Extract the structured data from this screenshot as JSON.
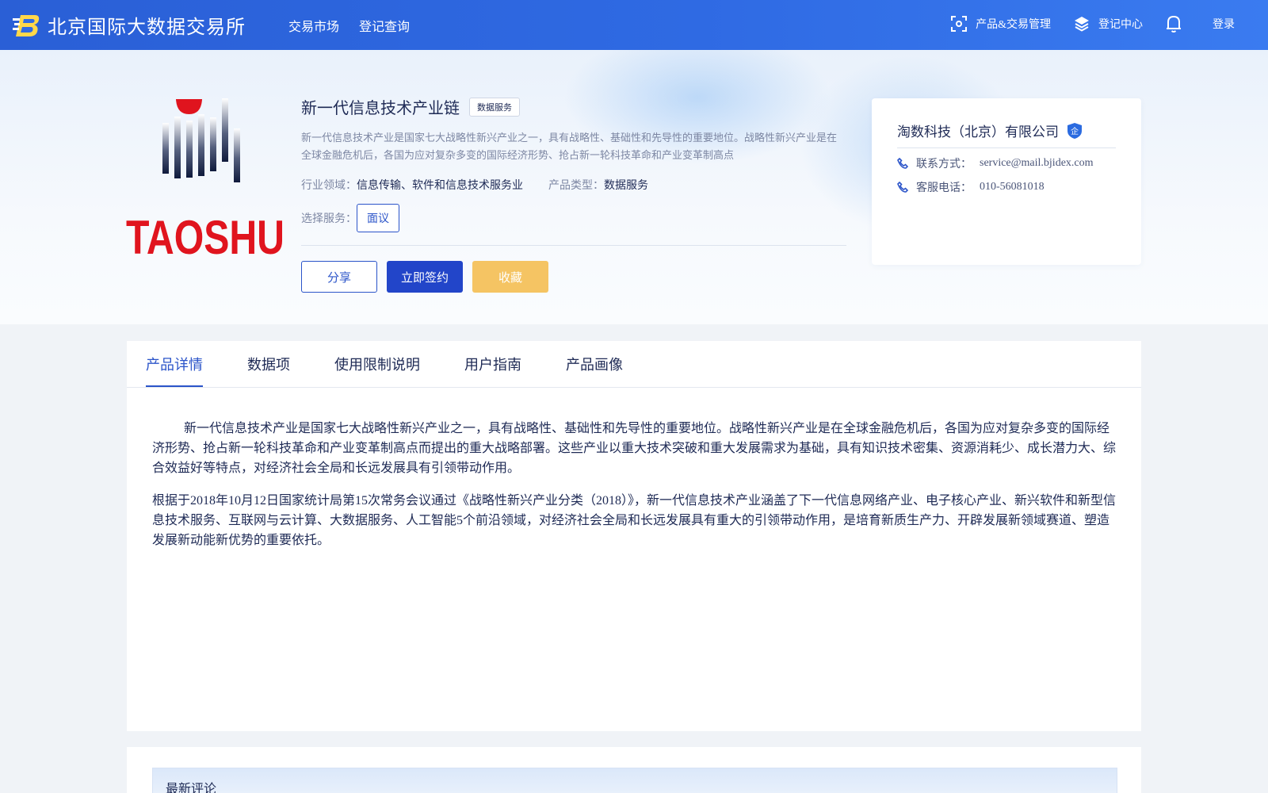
{
  "header": {
    "brand_name": "北京国际大数据交易所",
    "nav": [
      "交易市场",
      "登记查询"
    ],
    "right": {
      "product_mgmt": "产品&交易管理",
      "registry_center": "登记中心",
      "login": "登录"
    }
  },
  "product": {
    "logo_text": "TAOSHU",
    "title": "新一代信息技术产业链",
    "tag": "数据服务",
    "summary": "新一代信息技术产业是国家七大战略性新兴产业之一，具有战略性、基础性和先导性的重要地位。战略性新兴产业是在全球金融危机后，各国为应对复杂多变的国际经济形势、抢占新一轮科技革命和产业变革制高点",
    "industry_label": "行业领域：",
    "industry_value": "信息传输、软件和信息技术服务业",
    "type_label": "产品类型：",
    "type_value": "数据服务",
    "service_label": "选择服务：",
    "service_option": "面议",
    "actions": {
      "share": "分享",
      "sign": "立即签约",
      "favorite": "收藏"
    }
  },
  "company": {
    "name": "淘数科技（北京）有限公司",
    "cert_badge": "企",
    "contact_label": "联系方式：",
    "contact_value": "service@mail.bjidex.com",
    "phone_label": "客服电话：",
    "phone_value": "010-56081018"
  },
  "tabs": [
    "产品详情",
    "数据项",
    "使用限制说明",
    "用户指南",
    "产品画像"
  ],
  "active_tab": 0,
  "detail": {
    "p1": "新一代信息技术产业是国家七大战略性新兴产业之一，具有战略性、基础性和先导性的重要地位。战略性新兴产业是在全球金融危机后，各国为应对复杂多变的国际经济形势、抢占新一轮科技革命和产业变革制高点而提出的重大战略部署。这些产业以重大技术突破和重大发展需求为基础，具有知识技术密集、资源消耗少、成长潜力大、综合效益好等特点，对经济社会全局和长远发展具有引领带动作用。",
    "p2": "根据于2018年10月12日国家统计局第15次常务会议通过《战略性新兴产业分类（2018）》，新一代信息技术产业涵盖了下一代信息网络产业、电子核心产业、新兴软件和新型信息技术服务、互联网与云计算、大数据服务、人工智能5个前沿领域，对经济社会全局和长远发展具有重大的引领带动作用，是培育新质生产力、开辟发展新领域赛道、塑造发展新动能新优势的重要依托。"
  },
  "comments": {
    "title": "最新评论"
  },
  "colors": {
    "nav_bg": "#2f6ae3",
    "accent": "#2b54c9",
    "sign_button": "#2245c9",
    "favorite_button": "#f5c463",
    "logo_red": "#e0141e",
    "text_dark": "#1e2a55"
  }
}
